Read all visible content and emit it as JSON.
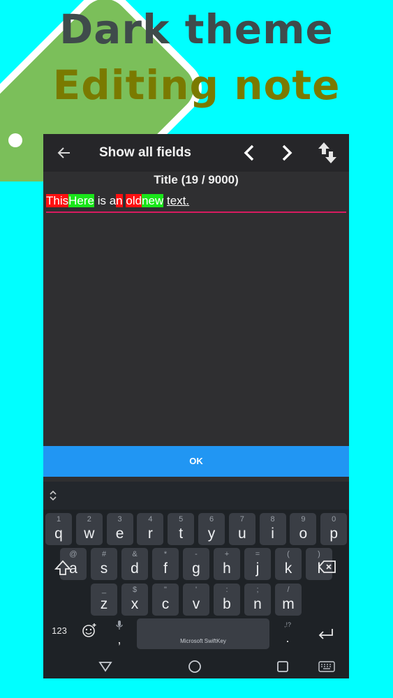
{
  "hero": {
    "line1": "Dark theme",
    "line2": "Editing note"
  },
  "appbar": {
    "back_icon": "arrow-left-icon",
    "title": "Show all fields",
    "prev_icon": "chevron-left-icon",
    "next_icon": "chevron-right-icon",
    "swap_icon": "swap-vertical-icon"
  },
  "field": {
    "label": "Title (19 / 9000)",
    "segments": [
      {
        "text": "This",
        "style": "deleted"
      },
      {
        "text": "Here",
        "style": "inserted"
      },
      {
        "text": " is a",
        "style": "plain"
      },
      {
        "text": "n",
        "style": "deleted"
      },
      {
        "text": " ",
        "style": "plain"
      },
      {
        "text": "old",
        "style": "deleted"
      },
      {
        "text": "new",
        "style": "inserted"
      },
      {
        "text": " ",
        "style": "plain"
      },
      {
        "text": "text.",
        "style": "underline"
      }
    ],
    "colors": {
      "deleted": "#ff1010",
      "inserted": "#19e619",
      "underline_bar": "#d81b60"
    }
  },
  "ok_button": {
    "label": "OK",
    "color": "#2196f3"
  },
  "keyboard": {
    "row1": [
      {
        "main": "q",
        "sub": "1"
      },
      {
        "main": "w",
        "sub": "2"
      },
      {
        "main": "e",
        "sub": "3"
      },
      {
        "main": "r",
        "sub": "4"
      },
      {
        "main": "t",
        "sub": "5"
      },
      {
        "main": "y",
        "sub": "6"
      },
      {
        "main": "u",
        "sub": "7"
      },
      {
        "main": "i",
        "sub": "8"
      },
      {
        "main": "o",
        "sub": "9"
      },
      {
        "main": "p",
        "sub": "0"
      }
    ],
    "row2": [
      {
        "main": "a",
        "sub": "@"
      },
      {
        "main": "s",
        "sub": "#"
      },
      {
        "main": "d",
        "sub": "&"
      },
      {
        "main": "f",
        "sub": "*"
      },
      {
        "main": "g",
        "sub": "-"
      },
      {
        "main": "h",
        "sub": "+"
      },
      {
        "main": "j",
        "sub": "="
      },
      {
        "main": "k",
        "sub": "("
      },
      {
        "main": "l",
        "sub": ")"
      }
    ],
    "row3": [
      {
        "main": "z",
        "sub": "_"
      },
      {
        "main": "x",
        "sub": "$"
      },
      {
        "main": "c",
        "sub": "\""
      },
      {
        "main": "v",
        "sub": "'"
      },
      {
        "main": "b",
        "sub": ":"
      },
      {
        "main": "n",
        "sub": ";"
      },
      {
        "main": "m",
        "sub": "/"
      }
    ],
    "numbers_key": "123",
    "comma_key": ",",
    "period_key": ".",
    "period_sub": ",!?",
    "space_label": "Microsoft SwiftKey",
    "icons": {
      "shift": "shift-icon",
      "backspace": "backspace-icon",
      "emoji": "emoji-icon",
      "mic": "mic-icon",
      "enter": "enter-icon",
      "expand": "expand-icon"
    }
  },
  "navbar": {
    "back": "nav-back-icon",
    "home": "nav-home-icon",
    "recents": "nav-recents-icon",
    "keyboard": "keyboard-icon"
  }
}
